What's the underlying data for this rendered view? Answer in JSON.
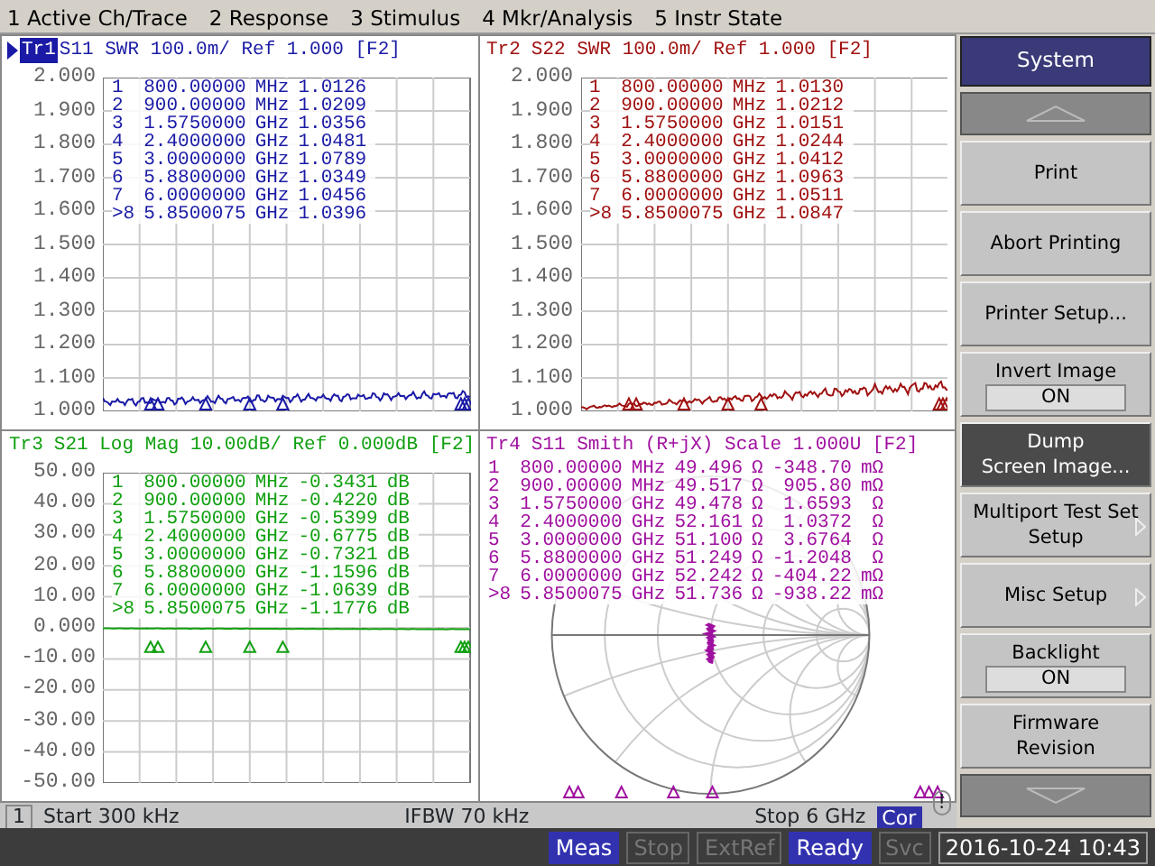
{
  "menu": [
    "1 Active Ch/Trace",
    "2 Response",
    "3 Stimulus",
    "4 Mkr/Analysis",
    "5 Instr State"
  ],
  "traces": [
    {
      "kind": "cartesian",
      "label": "Tr1",
      "active": true,
      "title": "S11 SWR 100.0m/ Ref 1.000 [F2]",
      "color": "#1a1aa6",
      "y_labels": [
        "2.000",
        "1.900",
        "1.800",
        "1.700",
        "1.600",
        "1.500",
        "1.400",
        "1.300",
        "1.200",
        "1.100",
        "1.000"
      ],
      "markers": [
        [
          "1",
          "800.00000",
          "MHz",
          "1.0126"
        ],
        [
          "2",
          "900.00000",
          "MHz",
          "1.0209"
        ],
        [
          "3",
          "1.5750000",
          "GHz",
          "1.0356"
        ],
        [
          "4",
          "2.4000000",
          "GHz",
          "1.0481"
        ],
        [
          "5",
          "3.0000000",
          "GHz",
          "1.0789"
        ],
        [
          "6",
          "5.8800000",
          "GHz",
          "1.0349"
        ],
        [
          "7",
          "6.0000000",
          "GHz",
          "1.0456"
        ],
        [
          ">8",
          "5.8500075",
          "GHz",
          "1.0396"
        ]
      ]
    },
    {
      "kind": "cartesian",
      "label": "Tr2",
      "active": false,
      "title": "S22 SWR 100.0m/ Ref 1.000 [F2]",
      "color": "#a01010",
      "y_labels": [
        "2.000",
        "1.900",
        "1.800",
        "1.700",
        "1.600",
        "1.500",
        "1.400",
        "1.300",
        "1.200",
        "1.100",
        "1.000"
      ],
      "markers": [
        [
          "1",
          "800.00000",
          "MHz",
          "1.0130"
        ],
        [
          "2",
          "900.00000",
          "MHz",
          "1.0212"
        ],
        [
          "3",
          "1.5750000",
          "GHz",
          "1.0151"
        ],
        [
          "4",
          "2.4000000",
          "GHz",
          "1.0244"
        ],
        [
          "5",
          "3.0000000",
          "GHz",
          "1.0412"
        ],
        [
          "6",
          "5.8800000",
          "GHz",
          "1.0963"
        ],
        [
          "7",
          "6.0000000",
          "GHz",
          "1.0511"
        ],
        [
          ">8",
          "5.8500075",
          "GHz",
          "1.0847"
        ]
      ]
    },
    {
      "kind": "cartesian",
      "label": "Tr3",
      "active": false,
      "title": "S21 Log Mag 10.00dB/ Ref 0.000dB [F2]",
      "color": "#10a010",
      "y_labels": [
        "50.00",
        "40.00",
        "30.00",
        "20.00",
        "10.00",
        "0.000",
        "-10.00",
        "-20.00",
        "-30.00",
        "-40.00",
        "-50.00"
      ],
      "markers": [
        [
          "1",
          "800.00000",
          "MHz",
          "-0.3431",
          "dB"
        ],
        [
          "2",
          "900.00000",
          "MHz",
          "-0.4220",
          "dB"
        ],
        [
          "3",
          "1.5750000",
          "GHz",
          "-0.5399",
          "dB"
        ],
        [
          "4",
          "2.4000000",
          "GHz",
          "-0.6775",
          "dB"
        ],
        [
          "5",
          "3.0000000",
          "GHz",
          "-0.7321",
          "dB"
        ],
        [
          "6",
          "5.8800000",
          "GHz",
          "-1.1596",
          "dB"
        ],
        [
          "7",
          "6.0000000",
          "GHz",
          "-1.0639",
          "dB"
        ],
        [
          ">8",
          "5.8500075",
          "GHz",
          "-1.1776",
          "dB"
        ]
      ]
    },
    {
      "kind": "smith",
      "label": "Tr4",
      "active": false,
      "title": "S11 Smith (R+jX) Scale 1.000U [F2]",
      "color": "#a010a0",
      "markers": [
        [
          "1",
          "800.00000",
          "MHz",
          "49.496",
          "Ω",
          "-348.70",
          "mΩ"
        ],
        [
          "2",
          "900.00000",
          "MHz",
          "49.517",
          "Ω",
          "905.80",
          "mΩ"
        ],
        [
          "3",
          "1.5750000",
          "GHz",
          "49.478",
          "Ω",
          "1.6593",
          "Ω"
        ],
        [
          "4",
          "2.4000000",
          "GHz",
          "52.161",
          "Ω",
          "1.0372",
          "Ω"
        ],
        [
          "5",
          "3.0000000",
          "GHz",
          "51.100",
          "Ω",
          "3.6764",
          "Ω"
        ],
        [
          "6",
          "5.8800000",
          "GHz",
          "51.249",
          "Ω",
          "-1.2048",
          "Ω"
        ],
        [
          "7",
          "6.0000000",
          "GHz",
          "52.242",
          "Ω",
          "-404.22",
          "mΩ"
        ],
        [
          ">8",
          "5.8500075",
          "GHz",
          "51.736",
          "Ω",
          "-938.22",
          "mΩ"
        ]
      ]
    }
  ],
  "softkeys": {
    "title": "System",
    "keys": [
      {
        "label": "Print",
        "selected": false,
        "submenu": false
      },
      {
        "label": "Abort Printing",
        "selected": false,
        "submenu": false
      },
      {
        "label": "Printer Setup...",
        "selected": false,
        "submenu": false
      },
      {
        "label": "Invert Image",
        "value": "ON",
        "selected": false,
        "submenu": false
      },
      {
        "label": "Dump\nScreen Image...",
        "selected": true,
        "submenu": false
      },
      {
        "label": "Multiport Test Set\nSetup",
        "selected": false,
        "submenu": true
      },
      {
        "label": "Misc Setup",
        "selected": false,
        "submenu": true
      },
      {
        "label": "Backlight",
        "value": "ON",
        "selected": false,
        "submenu": false
      },
      {
        "label": "Firmware\nRevision",
        "selected": false,
        "submenu": false
      }
    ]
  },
  "channel_bar": {
    "channel": "1",
    "start": "Start 300 kHz",
    "ifbw": "IFBW 70 kHz",
    "stop": "Stop 6 GHz",
    "correction": "Cor",
    "alert": "!"
  },
  "status_bar": {
    "indicators": [
      {
        "label": "Meas",
        "on": true
      },
      {
        "label": "Stop",
        "on": false
      },
      {
        "label": "ExtRef",
        "on": false
      },
      {
        "label": "Ready",
        "on": true
      },
      {
        "label": "Svc",
        "on": false
      }
    ],
    "datetime": "2016-10-24 10:43"
  }
}
